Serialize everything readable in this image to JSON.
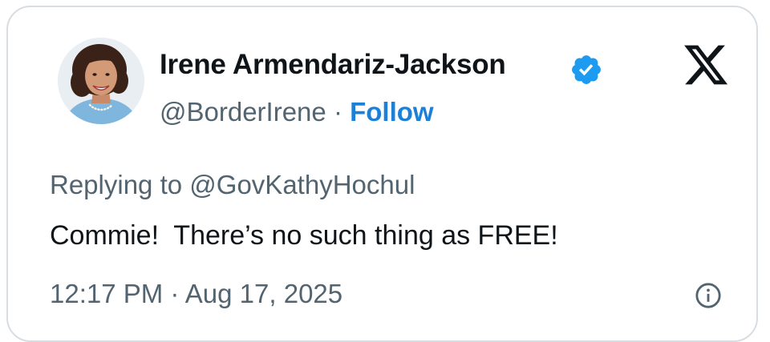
{
  "tweet": {
    "author": {
      "display_name": "Irene Armendariz-Jackson",
      "handle": "@BorderIrene",
      "verified": true,
      "avatar_icon": "profile-photo"
    },
    "follow_separator": "·",
    "follow_label": "Follow",
    "reply_to_prefix": "Replying to",
    "reply_to_handle": "@GovKathyHochul",
    "text": "Commie!  There’s no such thing as FREE!",
    "time": "12:17 PM",
    "date_separator": "·",
    "date": "Aug 17, 2025",
    "brand_icon": "x-logo-icon",
    "info_icon": "info-icon"
  },
  "colors": {
    "text_primary": "#0f1419",
    "text_secondary": "#536471",
    "accent": "#1d80d6",
    "verified_badge": "#1d9bf0",
    "card_border": "#d8dde2"
  }
}
